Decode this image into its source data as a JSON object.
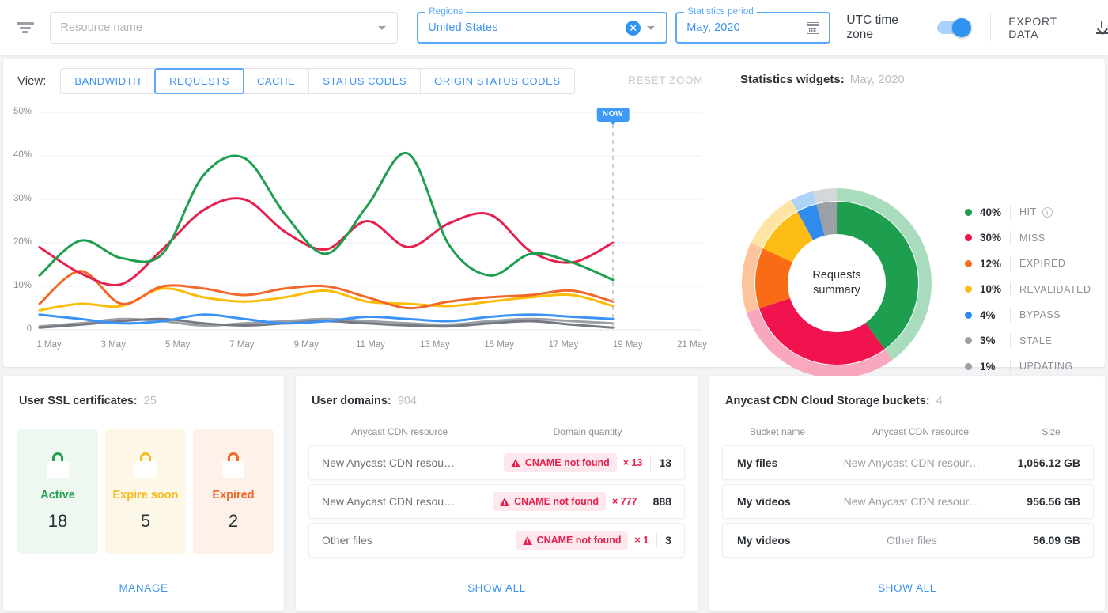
{
  "header": {
    "filter_icon": "filter-icon",
    "resource_placeholder": "Resource name",
    "regions_label": "Regions",
    "regions_value": "United States",
    "period_label": "Statistics period",
    "period_value": "May, 2020",
    "utc_label": "UTC time zone",
    "utc_enabled": true,
    "export_label": "EXPORT DATA"
  },
  "chart_panel": {
    "view_label": "View:",
    "tabs": [
      {
        "label": "BANDWIDTH",
        "active": false
      },
      {
        "label": "REQUESTS",
        "active": true
      },
      {
        "label": "CACHE",
        "active": false
      },
      {
        "label": "STATUS CODES",
        "active": false
      },
      {
        "label": "ORIGIN STATUS CODES",
        "active": false
      }
    ],
    "reset_zoom_label": "RESET ZOOM",
    "stats_widgets_label": "Statistics widgets:",
    "stats_widgets_value": "May, 2020",
    "now_marker": "NOW"
  },
  "chart_data": {
    "type": "line",
    "title": "",
    "xlabel": "",
    "ylabel": "",
    "grid": true,
    "ylim": [
      0,
      50
    ],
    "yticks": [
      "0",
      "10%",
      "20%",
      "30%",
      "40%",
      "50%"
    ],
    "ytick_values": [
      0,
      10,
      20,
      30,
      40,
      50
    ],
    "x": [
      "1 May",
      "3 May",
      "5 May",
      "7 May",
      "9 May",
      "11 May",
      "13 May",
      "15 May",
      "17 May",
      "19 May",
      "21 May"
    ],
    "xticks": [
      "1 May",
      "3 May",
      "5 May",
      "7 May",
      "9 May",
      "11 May",
      "13 May",
      "15 May",
      "17 May",
      "19 May",
      "21 May"
    ],
    "now_at": "19 May",
    "series": [
      {
        "name": "HIT",
        "color": "#1e9e4f",
        "values": [
          12.5,
          20.5,
          16.5,
          17.5,
          35.5,
          39.5,
          26.5,
          17.5,
          28.5,
          40.5,
          19.5,
          12.5,
          17.5,
          15.5,
          11.5
        ]
      },
      {
        "name": "MISS",
        "color": "#e8204e",
        "values": [
          19.0,
          13.0,
          10.5,
          18.5,
          27.5,
          30.0,
          22.5,
          18.5,
          25.0,
          19.0,
          24.5,
          26.5,
          18.0,
          15.5,
          20.0
        ]
      },
      {
        "name": "EXPIRED",
        "color": "#f2682a",
        "values": [
          6.0,
          13.5,
          6.0,
          10.0,
          9.5,
          8.0,
          9.5,
          10.0,
          7.5,
          5.0,
          6.5,
          7.5,
          8.0,
          9.0,
          6.5
        ]
      },
      {
        "name": "REVALIDATED",
        "color": "#fbbc05",
        "values": [
          4.5,
          6.0,
          5.5,
          9.5,
          7.5,
          6.5,
          7.5,
          9.0,
          6.5,
          6.0,
          5.5,
          6.5,
          7.5,
          8.0,
          5.5
        ]
      },
      {
        "name": "BYPASS",
        "color": "#3d93f5",
        "values": [
          3.5,
          2.5,
          1.5,
          2.0,
          3.5,
          2.5,
          1.5,
          2.0,
          3.0,
          2.5,
          2.0,
          3.0,
          3.5,
          3.0,
          2.5
        ]
      },
      {
        "name": "STALE",
        "color": "#9aa0a6",
        "values": [
          0.8,
          1.5,
          2.5,
          2.0,
          1.0,
          1.5,
          2.0,
          2.5,
          2.0,
          1.5,
          1.2,
          2.0,
          2.5,
          2.0,
          1.5
        ]
      },
      {
        "name": "UPDATING",
        "color": "#757a80",
        "values": [
          0.5,
          1.2,
          2.0,
          2.5,
          1.5,
          1.0,
          1.5,
          2.0,
          1.5,
          1.0,
          0.8,
          1.5,
          2.0,
          1.2,
          0.5
        ]
      }
    ]
  },
  "donut": {
    "center_line1": "Requests",
    "center_line2": "summary",
    "type": "pie",
    "segments": [
      {
        "label": "HIT",
        "value": 40,
        "pct": "40%",
        "color": "#1e9e4f",
        "outer_color": "#a8dcbd",
        "info": true
      },
      {
        "label": "MISS",
        "value": 30,
        "pct": "30%",
        "color": "#f0134e",
        "outer_color": "#f8a7bd",
        "info": false
      },
      {
        "label": "EXPIRED",
        "value": 12,
        "pct": "12%",
        "color": "#fa6b16",
        "outer_color": "#fdc49b",
        "info": false
      },
      {
        "label": "REVALIDATED",
        "value": 10,
        "pct": "10%",
        "color": "#fdbc14",
        "outer_color": "#fee5a5",
        "info": false
      },
      {
        "label": "BYPASS",
        "value": 4,
        "pct": "4%",
        "color": "#2f8ced",
        "outer_color": "#aed3f8",
        "info": false
      },
      {
        "label": "STALE",
        "value": 3,
        "pct": "3%",
        "color": "#9aa0a6",
        "outer_color": "#d4d7da",
        "info": false
      },
      {
        "label": "UPDATING",
        "value": 1,
        "pct": "1%",
        "color": "#9aa0a6",
        "outer_color": "#d4d7da",
        "info": false
      }
    ]
  },
  "ssl_card": {
    "title": "User SSL certificates:",
    "count": "25",
    "tiles": [
      {
        "name": "Active",
        "value": "18",
        "tone": "green"
      },
      {
        "name": "Expire soon",
        "value": "5",
        "tone": "amber"
      },
      {
        "name": "Expired",
        "value": "2",
        "tone": "orange"
      }
    ],
    "lock_text": "SSL",
    "link": "MANAGE"
  },
  "domains_card": {
    "title": "User domains:",
    "count": "904",
    "columns": [
      "Anycast CDN resource",
      "Domain quantity"
    ],
    "rows": [
      {
        "resource": "New Anycast CDN resou…",
        "error": "CNAME not found",
        "error_count": "× 13",
        "quantity": "13"
      },
      {
        "resource": "New Anycast CDN resou…",
        "error": "CNAME not found",
        "error_count": "× 777",
        "quantity": "888"
      },
      {
        "resource": "Other files",
        "error": "CNAME not found",
        "error_count": "× 1",
        "quantity": "3"
      }
    ],
    "link": "SHOW ALL"
  },
  "buckets_card": {
    "title": "Anycast CDN Cloud Storage buckets:",
    "count": "4",
    "columns": [
      "Bucket name",
      "Anycast CDN resource",
      "Size"
    ],
    "rows": [
      {
        "bucket": "My files",
        "resource": "New Anycast CDN resour…",
        "size": "1,056.12 GB"
      },
      {
        "bucket": "My videos",
        "resource": "New Anycast CDN resour…",
        "size": "956.56 GB"
      },
      {
        "bucket": "My videos",
        "resource": "Other files",
        "size": "56.09 GB"
      }
    ],
    "link": "SHOW ALL"
  }
}
